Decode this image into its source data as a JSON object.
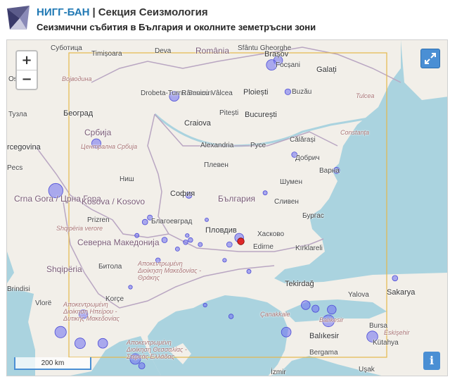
{
  "header": {
    "org": "НИГГ-БАН",
    "separator": "|",
    "section": "Секция Сеизмология",
    "subtitle": "Сеизмични събития в България и околните земетръсни зони"
  },
  "controls": {
    "zoom_in": "+",
    "zoom_out": "−",
    "info": "i",
    "scale_label": "200 km",
    "fullscreen_icon": "expand-arrows",
    "accent_color": "#4a8fd4"
  },
  "map_labels": [
    {
      "text": "Суботица",
      "cls": ""
    },
    {
      "text": "Timișoara",
      "cls": ""
    },
    {
      "text": "Deva",
      "cls": ""
    },
    {
      "text": "România",
      "cls": "country"
    },
    {
      "text": "Sfântu Gheorghe",
      "cls": ""
    },
    {
      "text": "Brașov",
      "cls": "big"
    },
    {
      "text": "Focșani",
      "cls": ""
    },
    {
      "text": "Galați",
      "cls": "big"
    },
    {
      "text": "Osijek",
      "cls": ""
    },
    {
      "text": "Војводина",
      "cls": "region"
    },
    {
      "text": "Drobeta-Turnu Severin",
      "cls": ""
    },
    {
      "text": "Râmnicu Vâlcea",
      "cls": ""
    },
    {
      "text": "Ploiești",
      "cls": "big"
    },
    {
      "text": "Buzău",
      "cls": ""
    },
    {
      "text": "Tulcea",
      "cls": "region"
    },
    {
      "text": "Београд",
      "cls": "big"
    },
    {
      "text": "Pitești",
      "cls": ""
    },
    {
      "text": "București",
      "cls": "big"
    },
    {
      "text": "Craiova",
      "cls": "big"
    },
    {
      "text": "Тузла",
      "cls": ""
    },
    {
      "text": "Србија",
      "cls": "country"
    },
    {
      "text": "Constanța",
      "cls": "region"
    },
    {
      "text": "Alexandria",
      "cls": ""
    },
    {
      "text": "Русе",
      "cls": ""
    },
    {
      "text": "Călărași",
      "cls": ""
    },
    {
      "text": "Централна Србија",
      "cls": "region"
    },
    {
      "text": "Добрич",
      "cls": ""
    },
    {
      "text": "rcegovina",
      "cls": "big"
    },
    {
      "text": "Плевен",
      "cls": ""
    },
    {
      "text": "Варна",
      "cls": ""
    },
    {
      "text": "Ниш",
      "cls": ""
    },
    {
      "text": "Шумен",
      "cls": ""
    },
    {
      "text": "Pecs",
      "cls": ""
    },
    {
      "text": "София",
      "cls": "big"
    },
    {
      "text": "Crna Gora / Црна Гора",
      "cls": "country"
    },
    {
      "text": "Kosova / Kosovo",
      "cls": "country"
    },
    {
      "text": "България",
      "cls": "country"
    },
    {
      "text": "Сливен",
      "cls": ""
    },
    {
      "text": "Prizren",
      "cls": ""
    },
    {
      "text": "Благоевград",
      "cls": ""
    },
    {
      "text": "Бургас",
      "cls": ""
    },
    {
      "text": "Shqipëria verore",
      "cls": "region"
    },
    {
      "text": "Пловдив",
      "cls": "big"
    },
    {
      "text": "Хасково",
      "cls": ""
    },
    {
      "text": "Северна Македонија",
      "cls": "country"
    },
    {
      "text": "Edirne",
      "cls": ""
    },
    {
      "text": "Kırklareli",
      "cls": ""
    },
    {
      "text": "Shqipëria",
      "cls": "country"
    },
    {
      "text": "Битола",
      "cls": ""
    },
    {
      "text": "Αποκεντρωμένη Διοίκηση Μακεδονίας - Θράκης",
      "cls": "region"
    },
    {
      "text": "Brindisi",
      "cls": ""
    },
    {
      "text": "Korçe",
      "cls": ""
    },
    {
      "text": "Tekirdağ",
      "cls": "big"
    },
    {
      "text": "Vlorë",
      "cls": ""
    },
    {
      "text": "Yalova",
      "cls": ""
    },
    {
      "text": "Sakarya",
      "cls": "big"
    },
    {
      "text": "Αποκεντρωμένη Διοίκηση Ηπείρου - Δυτικής Μακεδονίας",
      "cls": "region"
    },
    {
      "text": "Çanakkale",
      "cls": "region"
    },
    {
      "text": "Balıkesir",
      "cls": "region"
    },
    {
      "text": "Bursa",
      "cls": ""
    },
    {
      "text": "Eskişehir",
      "cls": "region"
    },
    {
      "text": "Balıkesir",
      "cls": "big"
    },
    {
      "text": "Bergama",
      "cls": ""
    },
    {
      "text": "Αποκεντρωμένη Διοίκηση Θεσσαλίας - Στερεάς Ελλάδας",
      "cls": "region"
    },
    {
      "text": "Kütahya",
      "cls": ""
    },
    {
      "text": "Uşak",
      "cls": ""
    },
    {
      "text": "İzmir",
      "cls": ""
    }
  ],
  "events": [
    {
      "lon": 25.75,
      "lat": 45.65,
      "mag": 3.6,
      "kind": "normal"
    },
    {
      "lon": 25.55,
      "lat": 45.55,
      "mag": 4.0,
      "kind": "normal"
    },
    {
      "lon": 22.55,
      "lat": 44.85,
      "mag": 3.8,
      "kind": "normal"
    },
    {
      "lon": 26.05,
      "lat": 44.95,
      "mag": 2.9,
      "kind": "normal"
    },
    {
      "lon": 20.15,
      "lat": 43.8,
      "mag": 3.7,
      "kind": "normal"
    },
    {
      "lon": 18.9,
      "lat": 42.75,
      "mag": 4.9,
      "kind": "normal"
    },
    {
      "lon": 26.25,
      "lat": 43.55,
      "mag": 2.8,
      "kind": "normal"
    },
    {
      "lon": 27.55,
      "lat": 43.2,
      "mag": 3.0,
      "kind": "normal"
    },
    {
      "lon": 23.0,
      "lat": 42.65,
      "mag": 3.0,
      "kind": "normal"
    },
    {
      "lon": 21.8,
      "lat": 42.15,
      "mag": 2.7,
      "kind": "normal"
    },
    {
      "lon": 21.65,
      "lat": 42.05,
      "mag": 2.8,
      "kind": "normal"
    },
    {
      "lon": 21.4,
      "lat": 41.75,
      "mag": 2.5,
      "kind": "normal"
    },
    {
      "lon": 22.25,
      "lat": 41.65,
      "mag": 2.8,
      "kind": "normal"
    },
    {
      "lon": 22.65,
      "lat": 41.45,
      "mag": 2.5,
      "kind": "normal"
    },
    {
      "lon": 22.95,
      "lat": 41.75,
      "mag": 2.4,
      "kind": "normal"
    },
    {
      "lon": 23.05,
      "lat": 41.65,
      "mag": 2.6,
      "kind": "normal"
    },
    {
      "lon": 22.9,
      "lat": 41.6,
      "mag": 2.6,
      "kind": "normal"
    },
    {
      "lon": 23.35,
      "lat": 41.55,
      "mag": 2.5,
      "kind": "normal"
    },
    {
      "lon": 23.55,
      "lat": 42.1,
      "mag": 2.3,
      "kind": "normal"
    },
    {
      "lon": 24.25,
      "lat": 41.55,
      "mag": 2.8,
      "kind": "normal"
    },
    {
      "lon": 24.55,
      "lat": 41.7,
      "mag": 3.6,
      "kind": "normal"
    },
    {
      "lon": 24.6,
      "lat": 41.62,
      "mag": 3.1,
      "kind": "latest"
    },
    {
      "lon": 25.35,
      "lat": 42.7,
      "mag": 2.5,
      "kind": "normal"
    },
    {
      "lon": 24.1,
      "lat": 41.2,
      "mag": 2.4,
      "kind": "normal"
    },
    {
      "lon": 26.6,
      "lat": 40.2,
      "mag": 3.6,
      "kind": "normal"
    },
    {
      "lon": 26.9,
      "lat": 40.12,
      "mag": 3.2,
      "kind": "normal"
    },
    {
      "lon": 27.4,
      "lat": 40.1,
      "mag": 3.6,
      "kind": "normal"
    },
    {
      "lon": 27.3,
      "lat": 39.85,
      "mag": 4.3,
      "kind": "normal"
    },
    {
      "lon": 26.0,
      "lat": 39.6,
      "mag": 3.8,
      "kind": "normal"
    },
    {
      "lon": 28.65,
      "lat": 39.5,
      "mag": 4.1,
      "kind": "normal"
    },
    {
      "lon": 24.3,
      "lat": 39.95,
      "mag": 2.6,
      "kind": "normal"
    },
    {
      "lon": 23.5,
      "lat": 40.2,
      "mag": 2.4,
      "kind": "normal"
    },
    {
      "lon": 21.2,
      "lat": 40.6,
      "mag": 2.4,
      "kind": "normal"
    },
    {
      "lon": 19.75,
      "lat": 40.0,
      "mag": 3.6,
      "kind": "normal"
    },
    {
      "lon": 19.05,
      "lat": 39.6,
      "mag": 4.2,
      "kind": "normal"
    },
    {
      "lon": 19.65,
      "lat": 39.35,
      "mag": 4.0,
      "kind": "normal"
    },
    {
      "lon": 20.35,
      "lat": 39.35,
      "mag": 3.8,
      "kind": "normal"
    },
    {
      "lon": 21.35,
      "lat": 39.0,
      "mag": 4.0,
      "kind": "normal"
    },
    {
      "lon": 21.55,
      "lat": 38.85,
      "mag": 3.0,
      "kind": "normal"
    },
    {
      "lon": 22.05,
      "lat": 41.2,
      "mag": 2.6,
      "kind": "normal"
    },
    {
      "lon": 29.35,
      "lat": 40.8,
      "mag": 2.8,
      "kind": "normal"
    },
    {
      "lon": 24.85,
      "lat": 40.95,
      "mag": 2.5,
      "kind": "normal"
    }
  ],
  "colors": {
    "sea": "#aad3df",
    "land": "#f2efe9",
    "event_fill": "#6e6ef0",
    "latest_fill": "#e02020",
    "bbox": "#e4b84c"
  }
}
